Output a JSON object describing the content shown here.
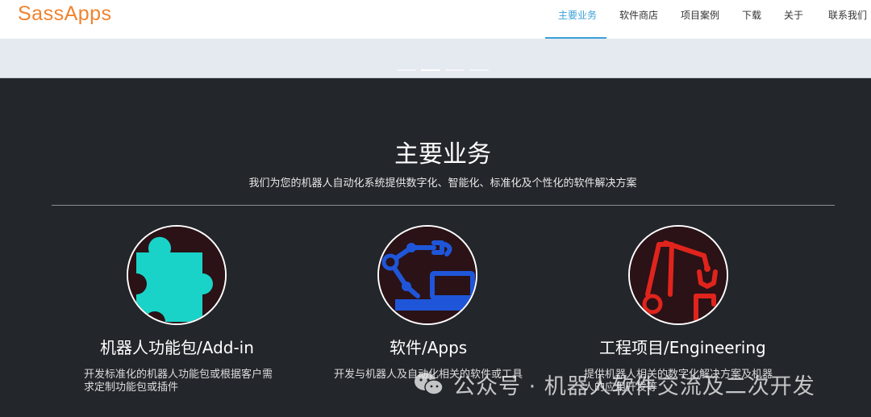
{
  "header": {
    "logo": "SassApps",
    "nav": [
      {
        "label": "主要业务",
        "active": true
      },
      {
        "label": "软件商店",
        "active": false
      },
      {
        "label": "项目案例",
        "active": false
      },
      {
        "label": "下载",
        "active": false
      },
      {
        "label": "关于",
        "active": false
      },
      {
        "label": "联系我们",
        "active": false
      }
    ],
    "accent_color": "#3aa0d8",
    "logo_color": "#f0832f"
  },
  "banner": {
    "slide_count": 4,
    "active_slide": 2
  },
  "section": {
    "title": "主要业务",
    "subtitle": "我们为您的机器人自动化系统提供数字化、智能化、标准化及个性化的软件解决方案"
  },
  "cards": [
    {
      "icon": "puzzle-piece-icon",
      "icon_color": "#19d3c8",
      "title": "机器人功能包/Add-in",
      "description": "开发标准化的机器人功能包或根据客户需求定制功能包或插件"
    },
    {
      "icon": "robot-arm-computer-icon",
      "icon_color": "#1f56d9",
      "title": "软件/Apps",
      "description": "开发与机器人及自动化相关的软件或工具"
    },
    {
      "icon": "robot-arm-gripper-icon",
      "icon_color": "#e0241d",
      "title": "工程项目/Engineering",
      "description": "提供机器人相关的数字化解决方案及机器人的应用开发等"
    }
  ],
  "watermark": {
    "icon": "wechat-icon",
    "text": "公众号 · 机器人软件交流及二次开发"
  }
}
